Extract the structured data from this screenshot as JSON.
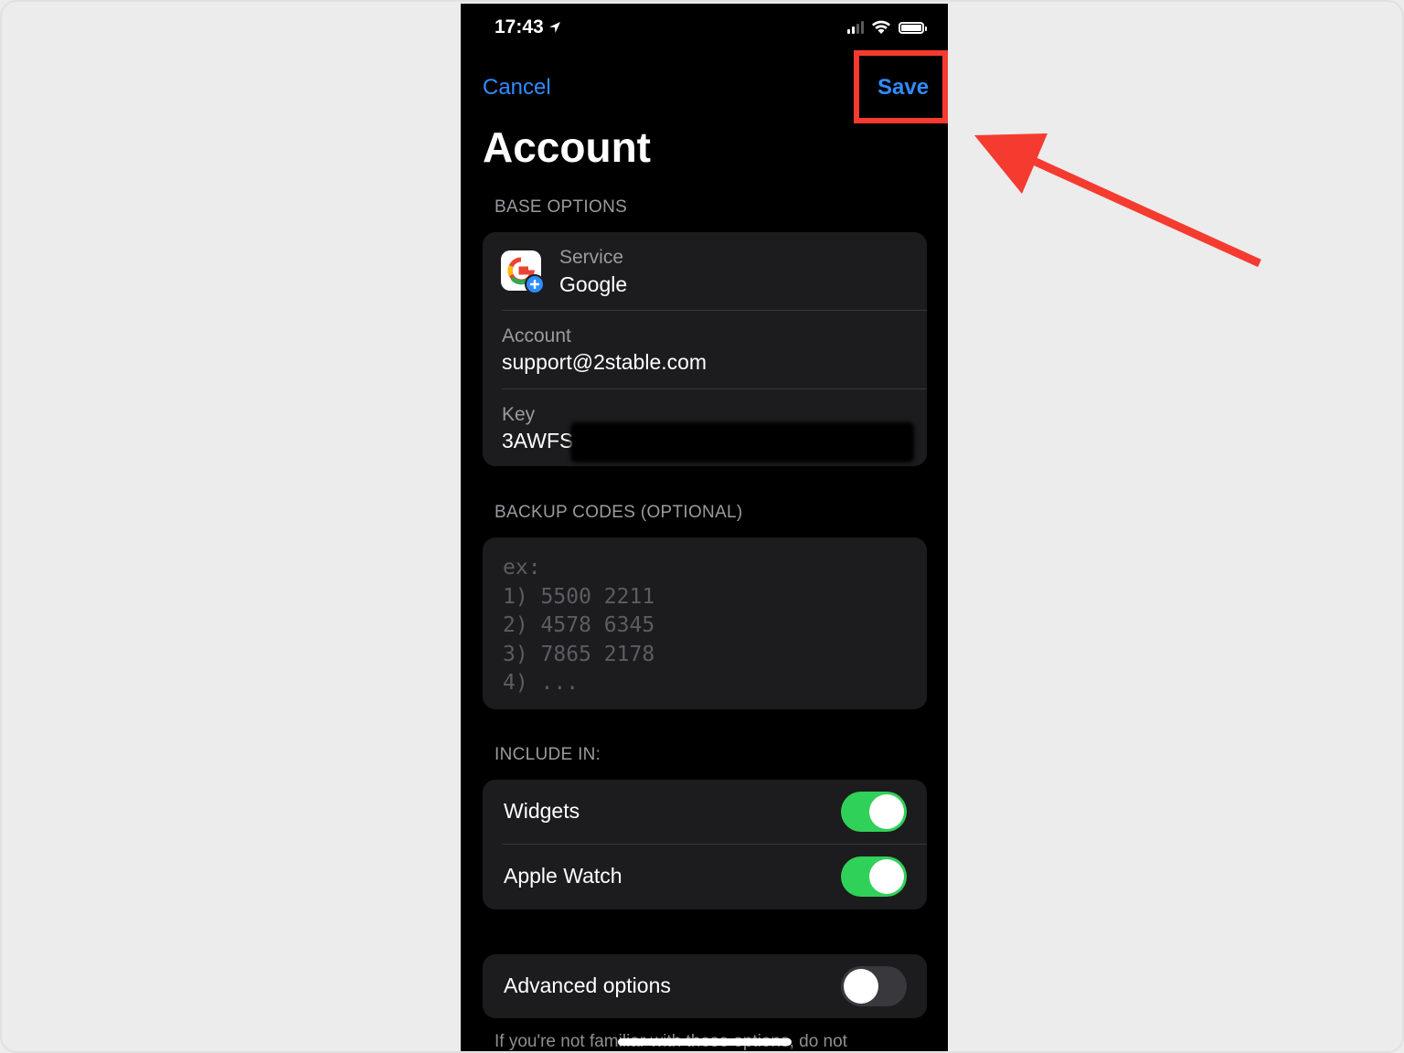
{
  "status_bar": {
    "time": "17:43",
    "location_icon": "location-arrow-icon",
    "signal_icon": "cellular-signal-icon",
    "wifi_icon": "wifi-icon",
    "battery_icon": "battery-icon"
  },
  "nav": {
    "cancel_label": "Cancel",
    "save_label": "Save"
  },
  "title": "Account",
  "base_options": {
    "header": "BASE OPTIONS",
    "service_label": "Service",
    "service_value": "Google",
    "service_icon": "google-add-icon",
    "account_label": "Account",
    "account_value": "support@2stable.com",
    "key_label": "Key",
    "key_value": "3AWFS"
  },
  "backup_codes": {
    "header": "BACKUP CODES (OPTIONAL)",
    "placeholder": "ex:\n1) 5500 2211\n2) 4578 6345\n3) 7865 2178\n4) ..."
  },
  "include_in": {
    "header": "INCLUDE IN:",
    "items": [
      {
        "label": "Widgets",
        "enabled": true
      },
      {
        "label": "Apple Watch",
        "enabled": true
      }
    ]
  },
  "advanced": {
    "label": "Advanced options",
    "enabled": false,
    "footnote": "If you're not familiar with these options, do not"
  },
  "colors": {
    "accent": "#2f8cff",
    "toggle_on": "#30d158",
    "annotation_red": "#f53b30"
  }
}
